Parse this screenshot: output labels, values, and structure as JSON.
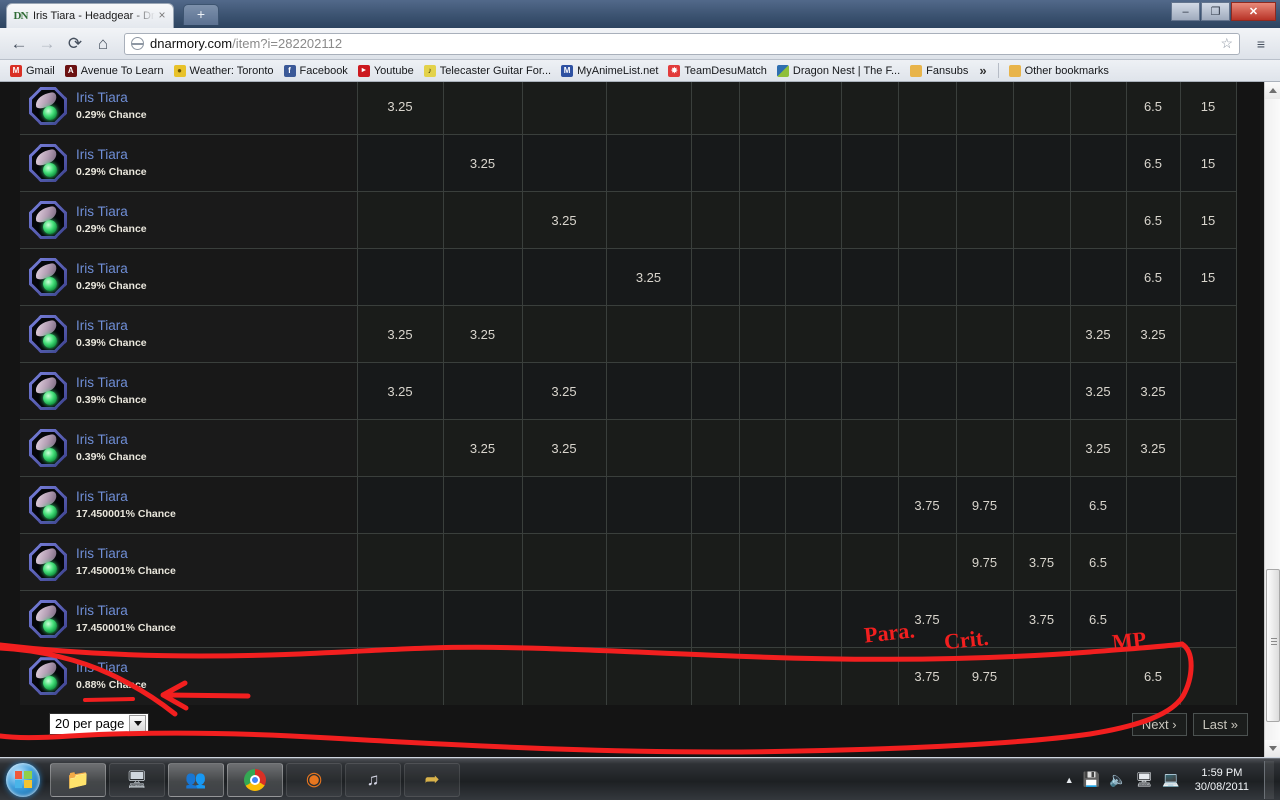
{
  "browser": {
    "tab": {
      "title": "Iris Tiara - Headgear - Drag",
      "favicon": "dn-logo-icon",
      "close": "×"
    },
    "newtab_label": "+",
    "window_controls": {
      "minimize": "–",
      "maximize": "❐",
      "close": "✕"
    },
    "nav": {
      "back": "←",
      "forward": "→",
      "reload": "⟳",
      "home": "⌂"
    },
    "omnibox": {
      "host": "dnarmory.com",
      "path": "/item?i=282202112",
      "full_url": "dnarmory.com/item?i=282202112",
      "star": "☆"
    },
    "menu_label": "≡",
    "bookmarks": [
      {
        "label": "Gmail",
        "icon": "gmail-icon",
        "color": "#d93025",
        "glyph": "M"
      },
      {
        "label": "Avenue To Learn",
        "icon": "avenue-icon",
        "color": "#6b1111",
        "glyph": "A"
      },
      {
        "label": "Weather: Toronto",
        "icon": "weather-icon",
        "color": "#e8c22a",
        "glyph": "●"
      },
      {
        "label": "Facebook",
        "icon": "facebook-icon",
        "color": "#3b5998",
        "glyph": "f"
      },
      {
        "label": "Youtube",
        "icon": "youtube-icon",
        "color": "#cc181e",
        "glyph": "▶"
      },
      {
        "label": "Telecaster Guitar For...",
        "icon": "telecaster-icon",
        "color": "#e3d24a",
        "glyph": "♪"
      },
      {
        "label": "MyAnimeList.net",
        "icon": "mal-icon",
        "color": "#2e51a2",
        "glyph": "M"
      },
      {
        "label": "TeamDesuMatch",
        "icon": "teamdesu-icon",
        "color": "#d33",
        "glyph": "✸"
      },
      {
        "label": "Dragon Nest | The F...",
        "icon": "dragonnest-icon",
        "color": "#2f6fb0",
        "glyph": "◢"
      },
      {
        "label": "Fansubs",
        "icon": "folder-icon",
        "color": "#e8b44a",
        "glyph": "▮"
      }
    ],
    "overflow_label": "»",
    "other_bookmarks": {
      "label": "Other bookmarks",
      "icon": "folder-icon",
      "color": "#e8b44a",
      "glyph": "▮"
    }
  },
  "page": {
    "item_name": "Iris Tiara",
    "item_icon": "iris-tiara-item-icon",
    "columns": 15,
    "rows": [
      {
        "name": "Iris Tiara",
        "chance": "0.29% Chance",
        "cells": [
          "3.25",
          "",
          "",
          "",
          "",
          "",
          "",
          "",
          "",
          "",
          "",
          "",
          "6.5",
          "15"
        ]
      },
      {
        "name": "Iris Tiara",
        "chance": "0.29% Chance",
        "cells": [
          "",
          "3.25",
          "",
          "",
          "",
          "",
          "",
          "",
          "",
          "",
          "",
          "",
          "6.5",
          "15"
        ]
      },
      {
        "name": "Iris Tiara",
        "chance": "0.29% Chance",
        "cells": [
          "",
          "",
          "3.25",
          "",
          "",
          "",
          "",
          "",
          "",
          "",
          "",
          "",
          "6.5",
          "15"
        ]
      },
      {
        "name": "Iris Tiara",
        "chance": "0.29% Chance",
        "cells": [
          "",
          "",
          "",
          "3.25",
          "",
          "",
          "",
          "",
          "",
          "",
          "",
          "",
          "6.5",
          "15"
        ]
      },
      {
        "name": "Iris Tiara",
        "chance": "0.39% Chance",
        "cells": [
          "3.25",
          "3.25",
          "",
          "",
          "",
          "",
          "",
          "",
          "",
          "",
          "",
          "3.25",
          "3.25",
          ""
        ]
      },
      {
        "name": "Iris Tiara",
        "chance": "0.39% Chance",
        "cells": [
          "3.25",
          "",
          "3.25",
          "",
          "",
          "",
          "",
          "",
          "",
          "",
          "",
          "3.25",
          "3.25",
          ""
        ]
      },
      {
        "name": "Iris Tiara",
        "chance": "0.39% Chance",
        "cells": [
          "",
          "3.25",
          "3.25",
          "",
          "",
          "",
          "",
          "",
          "",
          "",
          "",
          "3.25",
          "3.25",
          ""
        ]
      },
      {
        "name": "Iris Tiara",
        "chance": "17.450001% Chance",
        "cells": [
          "",
          "",
          "",
          "",
          "",
          "",
          "",
          "",
          "3.75",
          "9.75",
          "",
          "6.5",
          "",
          ""
        ]
      },
      {
        "name": "Iris Tiara",
        "chance": "17.450001% Chance",
        "cells": [
          "",
          "",
          "",
          "",
          "",
          "",
          "",
          "",
          "",
          "9.75",
          "3.75",
          "6.5",
          "",
          ""
        ]
      },
      {
        "name": "Iris Tiara",
        "chance": "17.450001% Chance",
        "cells": [
          "",
          "",
          "",
          "",
          "",
          "",
          "",
          "",
          "3.75",
          "",
          "3.75",
          "6.5",
          "",
          ""
        ]
      },
      {
        "name": "Iris Tiara",
        "chance": "0.88% Chance",
        "cells": [
          "",
          "",
          "",
          "",
          "",
          "",
          "",
          "",
          "3.75",
          "9.75",
          "",
          "",
          "6.5",
          ""
        ]
      }
    ],
    "footer": {
      "per_page": "20 per page",
      "per_page_options": [
        "20 per page"
      ],
      "next": "Next ›",
      "last": "Last »"
    }
  },
  "annotations": {
    "color": "#f21f1f",
    "labels": [
      {
        "text": "Para.",
        "name": "annotation-para"
      },
      {
        "text": "Crit.",
        "name": "annotation-crit"
      },
      {
        "text": "MP",
        "name": "annotation-mp"
      }
    ]
  },
  "taskbar": {
    "start": "start-orb",
    "items": [
      {
        "name": "windows-explorer",
        "icon": "folder-icon",
        "glyph": "📁"
      },
      {
        "name": "task-manager",
        "icon": "monitor-icon",
        "glyph": "🖥"
      },
      {
        "name": "windows-live-messenger",
        "icon": "messenger-icon",
        "glyph": "👥"
      },
      {
        "name": "google-chrome",
        "icon": "chrome-icon",
        "glyph": "◉"
      },
      {
        "name": "mozilla-firefox",
        "icon": "firefox-icon",
        "glyph": "🦊"
      },
      {
        "name": "itunes",
        "icon": "itunes-icon",
        "glyph": "♫"
      },
      {
        "name": "dragon-nest-game",
        "icon": "dragon-icon",
        "glyph": "🐉"
      }
    ],
    "tray": {
      "show_hidden": "▲",
      "icons": [
        "network-icon",
        "volume-icon",
        "flash-drive-icon",
        "display-icon"
      ],
      "time": "1:59 PM",
      "date": "30/08/2011"
    }
  }
}
